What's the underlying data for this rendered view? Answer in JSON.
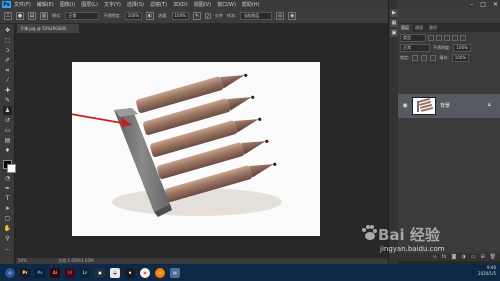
{
  "app": {
    "logo": "Ps"
  },
  "menubar": {
    "items": [
      "文件(F)",
      "编辑(E)",
      "图像(I)",
      "图层(L)",
      "文字(Y)",
      "选择(S)",
      "滤镜(T)",
      "3D(D)",
      "视图(V)",
      "窗口(W)",
      "帮助(H)"
    ],
    "minimize": "–",
    "maximize": "□",
    "close": "✕"
  },
  "options": {
    "mode_label": "模式:",
    "mode_value": "正常",
    "opacity_label": "不透明度:",
    "opacity_value": "100%",
    "flow_label": "流量:",
    "flow_value": "100%",
    "aligned_label": "对齐",
    "sample_label": "样本:",
    "sample_value": "当前图层"
  },
  "document": {
    "tab_label": "子弹.jpg @ 50%(RGB/8)",
    "status": "文档:1.65M/1.65M",
    "zoom": "50%"
  },
  "panel": {
    "tabs": [
      "图层",
      "通道",
      "路径"
    ],
    "filter_label": "类型",
    "blend_mode": "正常",
    "opacity_label": "不透明度:",
    "opacity_value": "100%",
    "lock_label": "锁定:",
    "fill_label": "填充:",
    "fill_value": "100%",
    "layer_name": "背景"
  },
  "taskbar": {
    "time": "9:46",
    "date": "2020/1/5"
  },
  "watermark": {
    "brand": "Bai 经验",
    "url": "jingyan.baidu.com"
  },
  "colors": {
    "arrow": "#c81e1e",
    "taskbar": "#0e2848",
    "accent": "#2ba3f0"
  }
}
